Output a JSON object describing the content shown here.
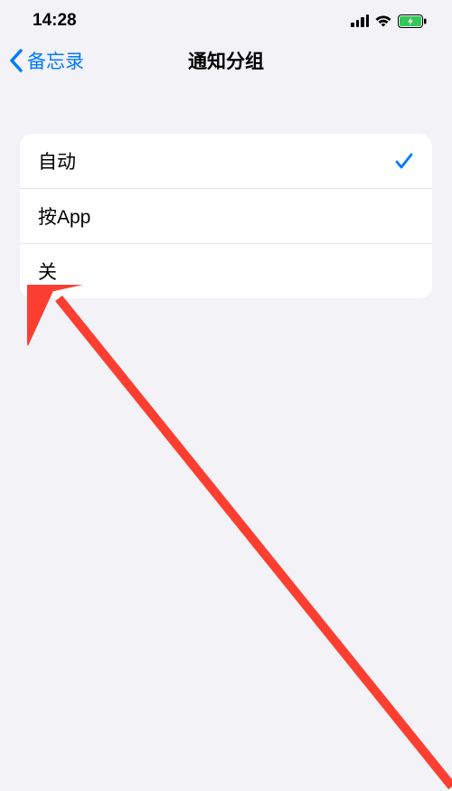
{
  "status": {
    "time": "14:28"
  },
  "nav": {
    "back_label": "备忘录",
    "title": "通知分组"
  },
  "options": {
    "items": [
      {
        "label": "自动",
        "selected": true
      },
      {
        "label": "按App",
        "selected": false
      },
      {
        "label": "关",
        "selected": false
      }
    ]
  }
}
